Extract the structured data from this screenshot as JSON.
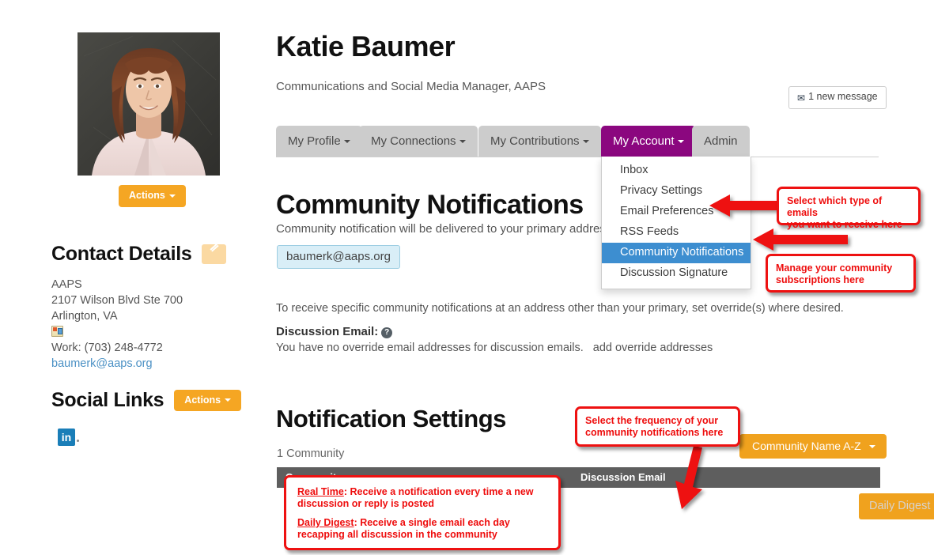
{
  "profile": {
    "name": "Katie Baumer",
    "subtitle": "Communications and Social Media Manager, AAPS",
    "avatar_alt": "profile-photo",
    "actions_label": "Actions",
    "new_message_label": "1 new message",
    "envelope_icon": "envelope-icon"
  },
  "tabs": [
    {
      "label": "My Profile",
      "has_caret": true,
      "active": false
    },
    {
      "label": "My Connections",
      "has_caret": true,
      "active": false
    },
    {
      "label": "My Contributions",
      "has_caret": true,
      "active": false
    },
    {
      "label": "My Account",
      "has_caret": true,
      "active": true
    },
    {
      "label": "Admin",
      "has_caret": false,
      "active": false
    }
  ],
  "account_menu": [
    {
      "label": "Inbox",
      "selected": false
    },
    {
      "label": "Privacy Settings",
      "selected": false
    },
    {
      "label": "Email Preferences",
      "selected": false
    },
    {
      "label": "RSS Feeds",
      "selected": false
    },
    {
      "label": "Community Notifications",
      "selected": true
    },
    {
      "label": "Discussion Signature",
      "selected": false
    }
  ],
  "contact": {
    "heading": "Contact Details",
    "edit_icon": "pencil-icon",
    "org": "AAPS",
    "street": "2107 Wilson Blvd Ste 700",
    "city_state": "Arlington, VA",
    "address_icon": "address-card-icon",
    "phone": "Work: (703) 248-4772",
    "email": "baumerk@aaps.org"
  },
  "social": {
    "heading": "Social Links",
    "actions_label": "Actions",
    "linkedin_icon": "linkedin-icon",
    "linkedin_label": "in"
  },
  "community_notifications": {
    "title": "Community Notifications",
    "description": "Community notification will be delivered to your primary address.",
    "primary_email": "baumerk@aaps.org",
    "override_text": "To receive specific community notifications at an address other than your primary, set override(s) where desired.",
    "discussion_email_label": "Discussion Email:",
    "help_icon": "question-mark-icon",
    "no_override_text": "You have no override email addresses for discussion emails.",
    "add_override_link": "add override addresses"
  },
  "notification_settings": {
    "title": "Notification Settings",
    "count": "1 Community",
    "sort_label": "Community Name A-Z",
    "columns": {
      "community": "Community",
      "discussion_email": "Discussion Email"
    },
    "rows": [
      {
        "discussion_email_value": "Daily Digest"
      }
    ]
  },
  "annotations": [
    {
      "id": "emails-type",
      "line1": "Select which type of emails",
      "line2": "you want to receive here"
    },
    {
      "id": "manage-subscriptions",
      "line1": "Manage your community",
      "line2": "subscriptions here"
    },
    {
      "id": "frequency",
      "line1": "Select the frequency of your",
      "line2": "community notifications here"
    }
  ],
  "legend_callout": {
    "real_time_term": "Real Time",
    "real_time_desc": ": Receive a notification every time a new discussion or reply is posted",
    "daily_digest_term": "Daily Digest",
    "daily_digest_desc": ": Receive a single email each day recapping all discussion in the community"
  },
  "colors": {
    "accent_purple": "#8b077f",
    "accent_orange": "#f0a21e",
    "annotation_red": "#ee1111",
    "selected_blue": "#3d8ed0",
    "table_header_gray": "#5e5e5e"
  }
}
